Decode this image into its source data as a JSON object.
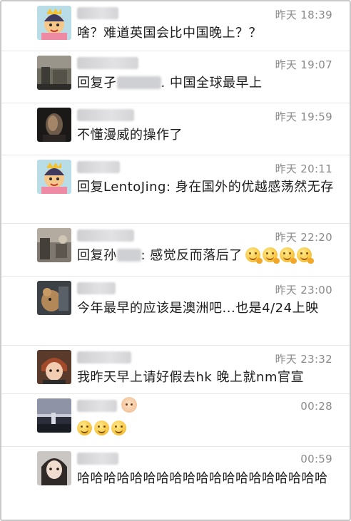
{
  "comments": [
    {
      "timestamp": "昨天 18:39",
      "content": "啥？难道英国会比中国晚上？？"
    },
    {
      "timestamp": "昨天 19:07",
      "name_visible": "L    Jing",
      "reply_prefix": "回复孑",
      "content": ". 中国全球最早上"
    },
    {
      "timestamp": "昨天 19:59",
      "content": "不懂漫威的操作了"
    },
    {
      "timestamp": "昨天 20:11",
      "content": "回复LentoJing: 身在国外的优越感荡然无存"
    },
    {
      "timestamp": "昨天 22:20",
      "reply_prefix": "回复孙",
      "content": ": 感觉反而落后了"
    },
    {
      "timestamp": "昨天 23:00",
      "content": "今年最早的应该是澳洲吧...也是4/24上映"
    },
    {
      "timestamp": "昨天 23:32",
      "content": "我昨天早上请好假去hk 晚上就nm官宣"
    },
    {
      "timestamp": "00:28",
      "content": ""
    },
    {
      "timestamp": "00:59",
      "content": "哈哈哈哈哈哈哈哈哈哈哈哈哈哈哈哈哈哈哈"
    }
  ],
  "icons": {
    "avatar_1": "cartoon-avatar-icon",
    "emoji_happy": "happy-hand-emoji-icon",
    "emoji_smile": "smile-emoji-icon",
    "emoji_baby": "baby-emoji-icon"
  }
}
